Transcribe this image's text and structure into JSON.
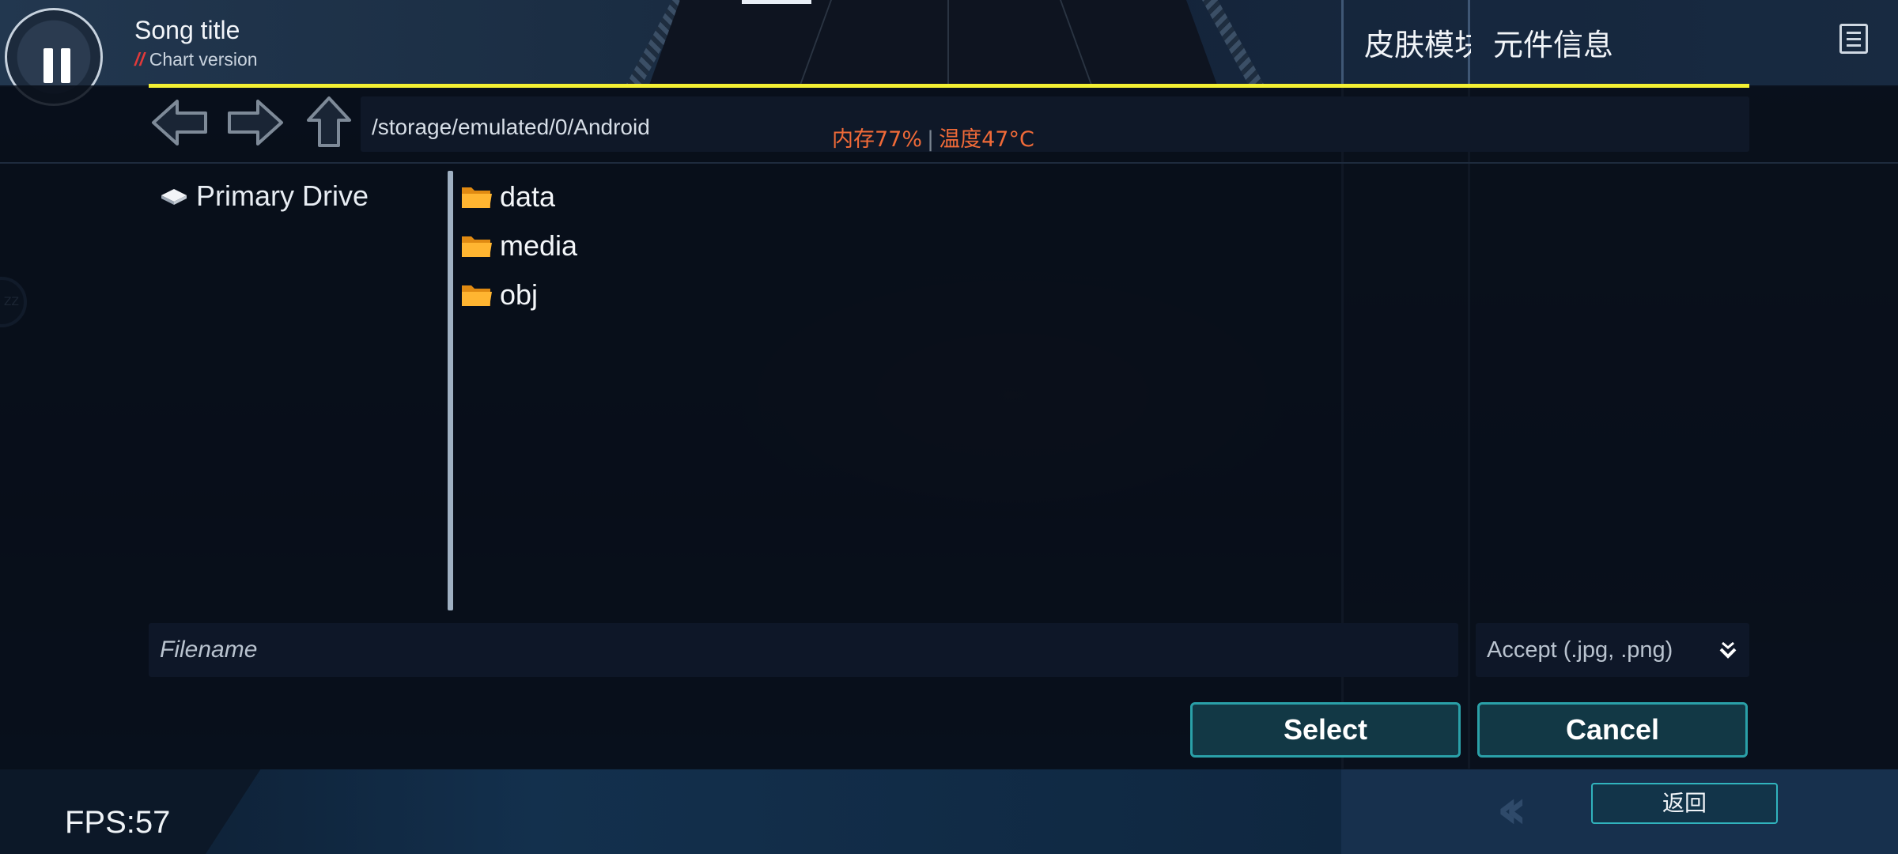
{
  "game": {
    "song_title": "Song title",
    "chart_version_prefix": "//",
    "chart_version": "Chart version",
    "fps": "FPS:57",
    "back_label": "返回",
    "side_badge": "ZZ"
  },
  "right_panel": {
    "skin_tab": "皮肤模块",
    "info_title": "元件信息",
    "doc_icon": "document-list-icon"
  },
  "file_dialog": {
    "nav": {
      "back_icon": "back-arrow-icon",
      "forward_icon": "forward-arrow-icon",
      "up_icon": "up-arrow-icon"
    },
    "path": "/storage/emulated/0/Android",
    "status": {
      "memory": "内存77%",
      "separator": "|",
      "temperature": "温度47°C",
      "color": "#f06a38"
    },
    "drives": [
      {
        "label": "Primary Drive",
        "icon": "drive-icon"
      }
    ],
    "files": [
      {
        "name": "data",
        "icon": "folder-icon"
      },
      {
        "name": "media",
        "icon": "folder-icon"
      },
      {
        "name": "obj",
        "icon": "folder-icon"
      }
    ],
    "filename_placeholder": "Filename",
    "filter_selected": "Accept (.jpg, .png)",
    "select_label": "Select",
    "cancel_label": "Cancel",
    "accent_color": "#2aa0a8",
    "highlight_color": "#f3f033"
  }
}
